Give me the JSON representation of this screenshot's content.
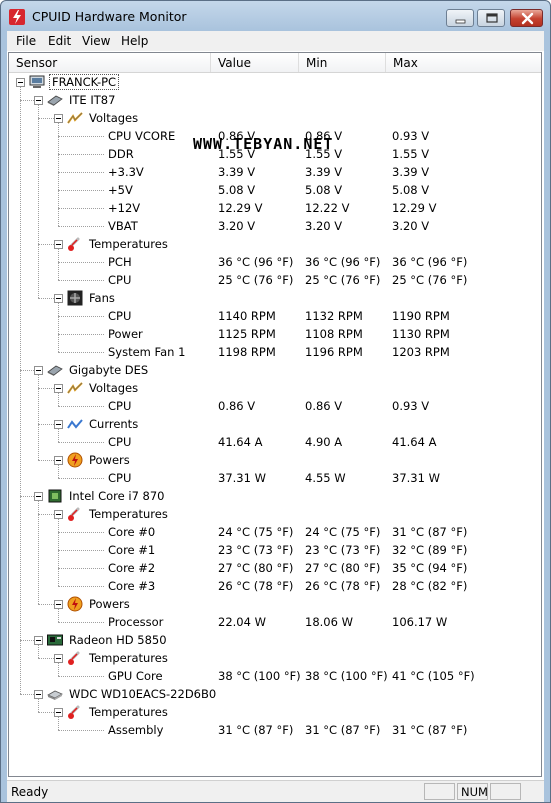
{
  "window": {
    "title": "CPUID Hardware Monitor"
  },
  "menu": [
    "File",
    "Edit",
    "View",
    "Help"
  ],
  "columns": [
    "Sensor",
    "Value",
    "Min",
    "Max"
  ],
  "watermark": "WWW.TEBYAN.NET",
  "status": {
    "text": "Ready",
    "num": "NUM"
  },
  "rows": [
    {
      "label": "FRANCK-PC",
      "level": 0,
      "icon": "computer-icon"
    },
    {
      "label": "ITE IT87",
      "level": 1,
      "icon": "chip-icon"
    },
    {
      "label": "Voltages",
      "level": 2,
      "icon": "voltage-icon"
    },
    {
      "label": "CPU VCORE",
      "level": 3,
      "value": "0.86 V",
      "min": "0.86 V",
      "max": "0.93 V"
    },
    {
      "label": "DDR",
      "level": 3,
      "value": "1.55 V",
      "min": "1.55 V",
      "max": "1.55 V"
    },
    {
      "label": "+3.3V",
      "level": 3,
      "value": "3.39 V",
      "min": "3.39 V",
      "max": "3.39 V"
    },
    {
      "label": "+5V",
      "level": 3,
      "value": "5.08 V",
      "min": "5.08 V",
      "max": "5.08 V"
    },
    {
      "label": "+12V",
      "level": 3,
      "value": "12.29 V",
      "min": "12.22 V",
      "max": "12.29 V"
    },
    {
      "label": "VBAT",
      "level": 3,
      "value": "3.20 V",
      "min": "3.20 V",
      "max": "3.20 V"
    },
    {
      "label": "Temperatures",
      "level": 2,
      "icon": "thermometer-icon"
    },
    {
      "label": "PCH",
      "level": 3,
      "value": "36 °C  (96 °F)",
      "min": "36 °C  (96 °F)",
      "max": "36 °C  (96 °F)"
    },
    {
      "label": "CPU",
      "level": 3,
      "value": "25 °C  (76 °F)",
      "min": "25 °C  (76 °F)",
      "max": "25 °C  (76 °F)"
    },
    {
      "label": "Fans",
      "level": 2,
      "icon": "fan-icon"
    },
    {
      "label": "CPU",
      "level": 3,
      "value": "1140 RPM",
      "min": "1132 RPM",
      "max": "1190 RPM"
    },
    {
      "label": "Power",
      "level": 3,
      "value": "1125 RPM",
      "min": "1108 RPM",
      "max": "1130 RPM"
    },
    {
      "label": "System Fan 1",
      "level": 3,
      "value": "1198 RPM",
      "min": "1196 RPM",
      "max": "1203 RPM"
    },
    {
      "label": "Gigabyte DES",
      "level": 1,
      "icon": "chip-icon"
    },
    {
      "label": "Voltages",
      "level": 2,
      "icon": "voltage-icon"
    },
    {
      "label": "CPU",
      "level": 3,
      "value": "0.86 V",
      "min": "0.86 V",
      "max": "0.93 V"
    },
    {
      "label": "Currents",
      "level": 2,
      "icon": "current-icon"
    },
    {
      "label": "CPU",
      "level": 3,
      "value": "41.64 A",
      "min": "4.90 A",
      "max": "41.64 A"
    },
    {
      "label": "Powers",
      "level": 2,
      "icon": "power-icon"
    },
    {
      "label": "CPU",
      "level": 3,
      "value": "37.31 W",
      "min": "4.55 W",
      "max": "37.31 W"
    },
    {
      "label": "Intel Core i7 870",
      "level": 1,
      "icon": "cpu-icon"
    },
    {
      "label": "Temperatures",
      "level": 2,
      "icon": "thermometer-icon"
    },
    {
      "label": "Core #0",
      "level": 3,
      "value": "24 °C  (75 °F)",
      "min": "24 °C  (75 °F)",
      "max": "31 °C  (87 °F)"
    },
    {
      "label": "Core #1",
      "level": 3,
      "value": "23 °C  (73 °F)",
      "min": "23 °C  (73 °F)",
      "max": "32 °C  (89 °F)"
    },
    {
      "label": "Core #2",
      "level": 3,
      "value": "27 °C  (80 °F)",
      "min": "27 °C  (80 °F)",
      "max": "35 °C  (94 °F)"
    },
    {
      "label": "Core #3",
      "level": 3,
      "value": "26 °C  (78 °F)",
      "min": "26 °C  (78 °F)",
      "max": "28 °C  (82 °F)"
    },
    {
      "label": "Powers",
      "level": 2,
      "icon": "power-icon"
    },
    {
      "label": "Processor",
      "level": 3,
      "value": "22.04 W",
      "min": "18.06 W",
      "max": "106.17 W"
    },
    {
      "label": "Radeon HD 5850",
      "level": 1,
      "icon": "gpu-icon"
    },
    {
      "label": "Temperatures",
      "level": 2,
      "icon": "thermometer-icon"
    },
    {
      "label": "GPU Core",
      "level": 3,
      "value": "38 °C  (100 °F)",
      "min": "38 °C  (100 °F)",
      "max": "41 °C  (105 °F)"
    },
    {
      "label": "WDC WD10EACS-22D6B0",
      "level": 1,
      "icon": "harddisk-icon"
    },
    {
      "label": "Temperatures",
      "level": 2,
      "icon": "thermometer-icon"
    },
    {
      "label": "Assembly",
      "level": 3,
      "value": "31 °C  (87 °F)",
      "min": "31 °C  (87 °F)",
      "max": "31 °C  (87 °F)"
    }
  ]
}
